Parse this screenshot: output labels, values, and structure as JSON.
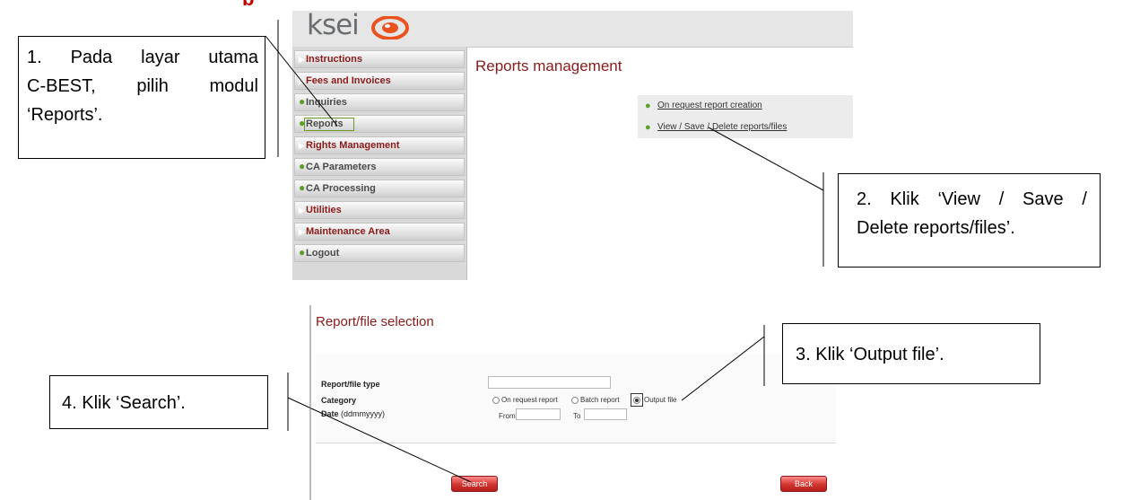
{
  "shot1": {
    "logo_text": "ksei",
    "menu": [
      {
        "label": "Instructions",
        "marker": "arrow",
        "color": "#8b1a1a"
      },
      {
        "label": "Fees and Invoices",
        "marker": "arrow",
        "color": "#8b1a1a"
      },
      {
        "label": "Inquiries",
        "marker": "dot",
        "color": "#4a4a4a"
      },
      {
        "label": "Reports",
        "marker": "dot",
        "color": "#4a4a4a",
        "highlighted": true
      },
      {
        "label": "Rights Management",
        "marker": "arrow",
        "color": "#8b1a1a"
      },
      {
        "label": "CA Parameters",
        "marker": "dot",
        "color": "#4a4a4a"
      },
      {
        "label": "CA Processing",
        "marker": "dot",
        "color": "#4a4a4a"
      },
      {
        "label": "Utilities",
        "marker": "arrow",
        "color": "#8b1a1a"
      },
      {
        "label": "Maintenance Area",
        "marker": "arrow",
        "color": "#8b1a1a"
      },
      {
        "label": "Logout",
        "marker": "dot",
        "color": "#4a4a4a"
      }
    ],
    "content_title": "Reports management",
    "links": [
      {
        "label": "On request report creation"
      },
      {
        "label": "View / Save / Delete reports/files"
      }
    ]
  },
  "shot2": {
    "title": "Report/file selection",
    "fields": {
      "type_label": "Report/file type",
      "category_label": "Category",
      "date_label": "Date",
      "date_hint": "(ddmmyyyy)",
      "from_label": "From",
      "to_label": "To"
    },
    "category_options": [
      {
        "label": "On request report",
        "selected": false
      },
      {
        "label": "Batch report",
        "selected": false
      },
      {
        "label": "Output file",
        "selected": true
      }
    ],
    "search_button": "Search",
    "back_button": "Back"
  },
  "callouts": {
    "c1_line1": "1. Pada layar utama",
    "c1_line2": "C-BEST, pilih modul",
    "c1_line3": "‘Reports’.",
    "c2_line1": "2. Klik ‘View / Save /",
    "c2_line2": "Delete reports/files’.",
    "c3": "3. Klik ‘Output file’.",
    "c4": "4. Klik ‘Search’."
  },
  "colors": {
    "brand_red": "#8b1a1a",
    "accent_green": "#5aa02c",
    "button_red": "#d0352f",
    "logo_orange": "#e8531e"
  },
  "top_heading_partial": "p"
}
